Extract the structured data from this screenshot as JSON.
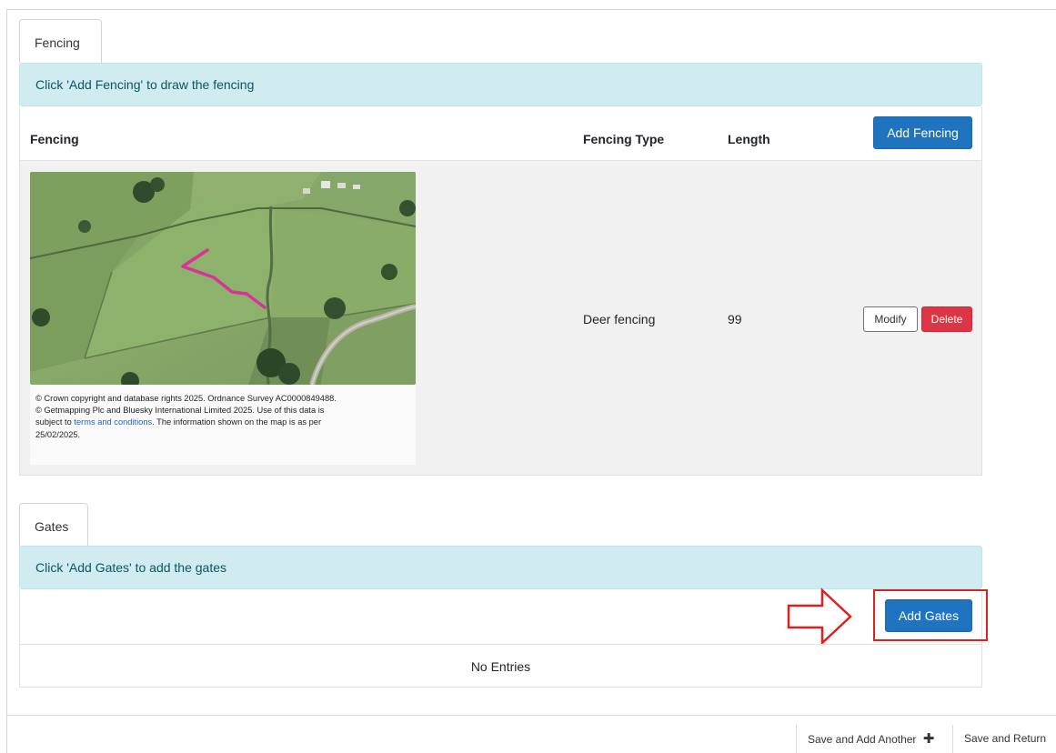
{
  "fencing": {
    "tab_label": "Fencing",
    "alert": "Click 'Add Fencing' to draw the fencing",
    "headers": {
      "fencing": "Fencing",
      "fencing_type": "Fencing Type",
      "length": "Length"
    },
    "add_button": "Add Fencing",
    "row": {
      "fencing_type": "Deer fencing",
      "length": "99",
      "modify": "Modify",
      "delete": "Delete"
    },
    "map_caption": {
      "line1": "© Crown copyright and database rights 2025. Ordnance Survey AC0000849488.",
      "line2": "© Getmapping Plc and Bluesky International Limited 2025. Use of this data is",
      "line3_pre": "subject to ",
      "link": "terms and conditions",
      "line3_post": ". The information shown on the map is as per",
      "line4": "25/02/2025."
    }
  },
  "gates": {
    "tab_label": "Gates",
    "alert": "Click 'Add Gates' to add the gates",
    "add_button": "Add Gates",
    "empty": "No Entries"
  },
  "footer": {
    "save_add_another": "Save and Add Another",
    "save_return": "Save and Return"
  },
  "colors": {
    "primary": "#1f73bf",
    "danger": "#dc3545",
    "alert_bg": "#d1ecf1",
    "annotation": "#e0201f",
    "fence_line": "#d6349a"
  },
  "icons": {
    "plus": "plus-icon",
    "arrow": "right-arrow-icon"
  }
}
